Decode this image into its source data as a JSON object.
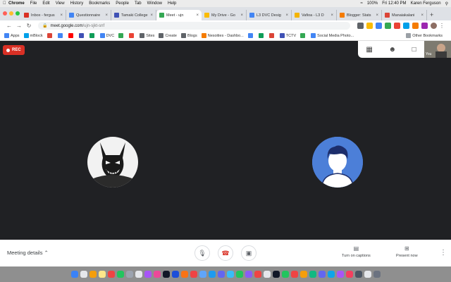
{
  "menubar": {
    "items": [
      "Chrome",
      "File",
      "Edit",
      "View",
      "History",
      "Bookmarks",
      "People",
      "Tab",
      "Window",
      "Help"
    ],
    "battery": "100%",
    "clock": "Fri 12:40 PM",
    "user": "Karen Ferguson"
  },
  "tabs": [
    {
      "label": "Inbox - fergus",
      "color": "#d93025"
    },
    {
      "label": "Questionnaire",
      "color": "#4285f4"
    },
    {
      "label": "Tamaki College",
      "color": "#3f51b5"
    },
    {
      "label": "Meet - ujn",
      "color": "#34a853",
      "active": true
    },
    {
      "label": "My Drive - Go",
      "color": "#fbbc04"
    },
    {
      "label": "L3 DVC Desig",
      "color": "#4285f4"
    },
    {
      "label": "Vafioa - L3 D",
      "color": "#f4b400"
    },
    {
      "label": "Blogger: Stats",
      "color": "#f57c00"
    },
    {
      "label": "Manaiakalani",
      "color": "#db4437"
    }
  ],
  "new_tab": "+",
  "url": {
    "host": "meet.google.com",
    "path": "/ujn-sjkt-snf"
  },
  "bookmarks": [
    {
      "label": "Apps",
      "color": "#4285f4"
    },
    {
      "label": "mBlock",
      "color": "#00a0e9"
    },
    {
      "label": "",
      "color": "#db4437"
    },
    {
      "label": "",
      "color": "#4285f4"
    },
    {
      "label": "",
      "color": "#ff0000"
    },
    {
      "label": "",
      "color": "#3f51b5"
    },
    {
      "label": "",
      "color": "#0f9d58"
    },
    {
      "label": "DVC",
      "color": "#4285f4"
    },
    {
      "label": "",
      "color": "#34a853"
    },
    {
      "label": "",
      "color": "#ea4335"
    },
    {
      "label": "Sites",
      "color": "#5f6368"
    },
    {
      "label": "Create",
      "color": "#5f6368"
    },
    {
      "label": "Blogs",
      "color": "#5f6368"
    },
    {
      "label": "Nesoities - Dashbo...",
      "color": "#f57c00"
    },
    {
      "label": "",
      "color": "#4285f4"
    },
    {
      "label": "",
      "color": "#0f9d58"
    },
    {
      "label": "",
      "color": "#db4437"
    },
    {
      "label": "TCTV",
      "color": "#3f51b5"
    },
    {
      "label": "",
      "color": "#34a853"
    },
    {
      "label": "Social Media Photo...",
      "color": "#4285f4"
    }
  ],
  "other_bookmarks": "Other Bookmarks",
  "meet": {
    "rec_label": "REC",
    "self_label": "You",
    "meeting_details": "Meeting details",
    "captions_label": "Turn on captions",
    "present_label": "Present now"
  },
  "dock_colors": [
    "#3b82f6",
    "#e5e7eb",
    "#f59e0b",
    "#fde68a",
    "#ef4444",
    "#22c55e",
    "#9ca3af",
    "#e5e7eb",
    "#a855f7",
    "#ec4899",
    "#111827",
    "#1d4ed8",
    "#f97316",
    "#ef4444",
    "#60a5fa",
    "#1d9bf0",
    "#6366f1",
    "#38bdf8",
    "#22c55e",
    "#8b5cf6",
    "#ef4444",
    "#e5e7eb",
    "#111827",
    "#22c55e",
    "#ef4444",
    "#f59e0b",
    "#10b981",
    "#6366f1",
    "#0ea5e9",
    "#a855f7",
    "#f43f5e",
    "#4b5563",
    "#e5e7eb",
    "#6b7280"
  ]
}
